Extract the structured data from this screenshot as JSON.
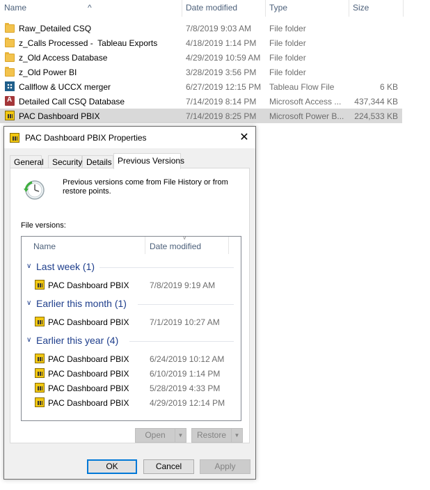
{
  "explorer": {
    "columns": {
      "name": "Name",
      "date": "Date modified",
      "type": "Type",
      "size": "Size"
    },
    "files": [
      {
        "icon": "folder-icon",
        "name": "Raw_Detailed CSQ",
        "date": "7/8/2019 9:03 AM",
        "type": "File folder",
        "size": ""
      },
      {
        "icon": "folder-icon",
        "name": "z_Calls Processed -  Tableau Exports",
        "date": "4/18/2019 1:14 PM",
        "type": "File folder",
        "size": ""
      },
      {
        "icon": "folder-icon",
        "name": "z_Old Access Database",
        "date": "4/29/2019 10:59 AM",
        "type": "File folder",
        "size": ""
      },
      {
        "icon": "folder-icon",
        "name": "z_Old Power BI",
        "date": "3/28/2019 3:56 PM",
        "type": "File folder",
        "size": ""
      },
      {
        "icon": "tableau-flow-icon",
        "name": "Callflow & UCCX merger",
        "date": "6/27/2019 12:15 PM",
        "type": "Tableau Flow File",
        "size": "6 KB"
      },
      {
        "icon": "access-database-icon",
        "name": "Detailed Call CSQ Database",
        "date": "7/14/2019 8:14 PM",
        "type": "Microsoft Access ...",
        "size": "437,344 KB"
      },
      {
        "icon": "power-bi-icon",
        "name": "PAC Dashboard PBIX",
        "date": "7/14/2019 8:25 PM",
        "type": "Microsoft Power B...",
        "size": "224,533 KB"
      }
    ]
  },
  "dialog": {
    "title": "PAC Dashboard PBIX Properties",
    "close_glyph": "✕",
    "tabs": [
      "General",
      "Security",
      "Details",
      "Previous Versions"
    ],
    "active_tab": "Previous Versions",
    "intro": "Previous versions come from File History or from restore points.",
    "file_versions_label": "File versions:",
    "list_columns": {
      "name": "Name",
      "date": "Date modified"
    },
    "groups": [
      {
        "label": "Last week (1)",
        "items": [
          {
            "name": "PAC Dashboard PBIX",
            "date": "7/8/2019 9:19 AM"
          }
        ]
      },
      {
        "label": "Earlier this month (1)",
        "items": [
          {
            "name": "PAC Dashboard PBIX",
            "date": "7/1/2019 10:27 AM"
          }
        ]
      },
      {
        "label": "Earlier this year (4)",
        "items": [
          {
            "name": "PAC Dashboard PBIX",
            "date": "6/24/2019 10:12 AM"
          },
          {
            "name": "PAC Dashboard PBIX",
            "date": "6/10/2019 1:14 PM"
          },
          {
            "name": "PAC Dashboard PBIX",
            "date": "5/28/2019 4:33 PM"
          },
          {
            "name": "PAC Dashboard PBIX",
            "date": "4/29/2019 12:14 PM"
          }
        ]
      }
    ],
    "buttons": {
      "open": "Open",
      "restore": "Restore",
      "ok": "OK",
      "cancel": "Cancel",
      "apply": "Apply"
    }
  },
  "colors": {
    "selected_row": "#d9d9d9",
    "group_heading": "#1e3e8c",
    "header_text": "#4c607a",
    "focus_border": "#0078d7"
  }
}
